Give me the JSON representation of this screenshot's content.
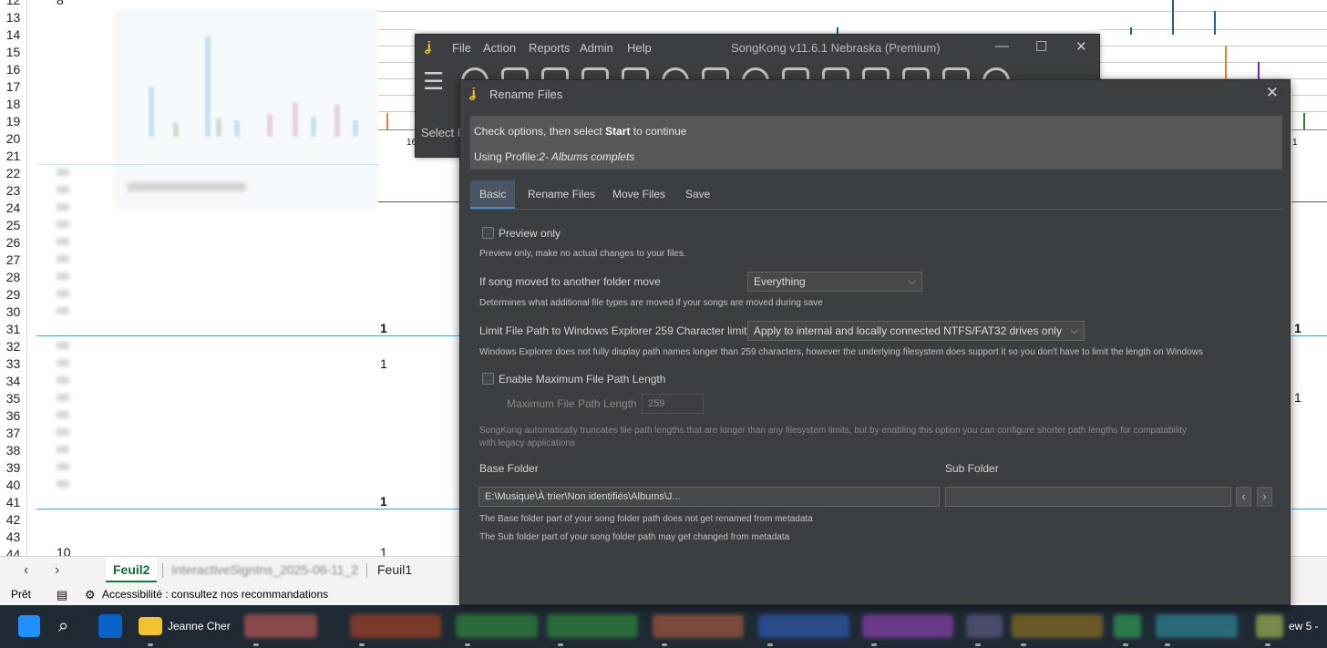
{
  "excel": {
    "row_numbers": [
      "12",
      "13",
      "14",
      "15",
      "16",
      "17",
      "18",
      "19",
      "20",
      "21",
      "22",
      "23",
      "24",
      "25",
      "26",
      "27",
      "28",
      "29",
      "30",
      "31",
      "32",
      "33",
      "34",
      "35",
      "36",
      "37",
      "38",
      "39",
      "40",
      "41",
      "42",
      "43",
      "44"
    ],
    "cells": {
      "top_left": "8",
      "r31_bold": "1",
      "r33": "1",
      "r41_bold": "1",
      "r44_left": "10",
      "r44_mid": "1",
      "right_31": "1",
      "right_35": "1",
      "chart_tick_left": "16",
      "chart_tick_right": "1"
    },
    "sheet_tabs": [
      "Feuil2",
      "InteractiveSignIns_2025-06-11_2",
      "Feuil1"
    ],
    "status_ready": "Prêt",
    "accessibility_text": "Accessibilité : consultez nos recommandations"
  },
  "taskbar": {
    "folder_label": "Jeanne Cher",
    "right_label": "ew 5 -"
  },
  "main_window": {
    "menu": [
      "File",
      "Action",
      "Reports",
      "Admin",
      "Help"
    ],
    "title": "SongKong v11.6.1 Nebraska (Premium)",
    "select_label": "Select Fo"
  },
  "dialog": {
    "title": "Rename Files",
    "info_prefix": "Check options, then select ",
    "info_bold": "Start",
    "info_suffix": " to continue",
    "profile_prefix": "Using Profile:",
    "profile_name": "2- Albums complets",
    "tabs": [
      "Basic",
      "Rename Files",
      "Move Files",
      "Save"
    ],
    "preview_only_label": "Preview only",
    "preview_only_desc": "Preview only, make no actual changes to your files.",
    "move_label": "If song moved to another folder move",
    "move_value": "Everything",
    "move_desc": "Determines what additional file types are moved if your songs are moved during save",
    "limit_label": "Limit File Path to Windows Explorer 259 Character limit",
    "limit_value": "Apply to internal and locally connected NTFS/FAT32 drives only",
    "limit_desc": "Windows Explorer does not fully display path names longer than 259 characters, however the underlying filesystem does support it so you don't have to limit the length on Windows",
    "enable_max_label": "Enable Maximum File Path Length",
    "max_len_label": "Maximum File Path Length",
    "max_len_value": "259",
    "truncate_desc_1": "SongKong automatically truncates file path lengths that are longer than any filesystem limits, but by enabling this option you can configure shorter path lengths for compatability",
    "truncate_desc_2": "with legacy applications",
    "base_folder_label": "Base Folder",
    "sub_folder_label": "Sub Folder",
    "base_folder_value": "E:\\Musique\\À trier\\Non identifiés\\Albums\\J...",
    "sub_folder_value": "",
    "base_desc": "The Base folder part of your song folder path does not get renamed from metadata",
    "sub_desc": "The Sub folder part of your song folder path may get changed from metadata"
  }
}
